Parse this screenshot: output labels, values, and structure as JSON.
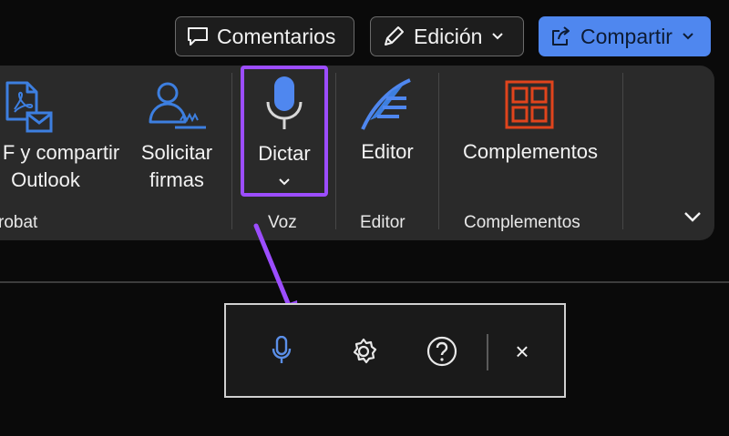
{
  "top_bar": {
    "comments_label": "Comentarios",
    "editing_label": "Edición",
    "share_label": "Compartir"
  },
  "ribbon": {
    "buttons": {
      "pdf_share_line1": "F y compartir",
      "pdf_share_line2": "Outlook",
      "request_sign_line1": "Solicitar",
      "request_sign_line2": "firmas",
      "dictate": "Dictar",
      "editor": "Editor",
      "addins": "Complementos"
    },
    "groups": {
      "acrobat": "robat",
      "voice": "Voz",
      "editor": "Editor",
      "addins": "Complementos"
    }
  },
  "dictation_toolbar": {
    "close_glyph": "×"
  },
  "colors": {
    "accent": "#4f87ef",
    "highlight": "#9c4dff",
    "addins_icon": "#e0441c",
    "mic_active": "#5b8fe8"
  }
}
